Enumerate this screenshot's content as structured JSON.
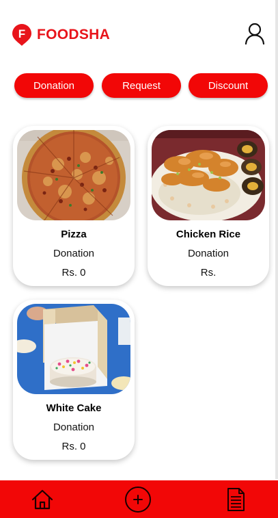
{
  "app": {
    "name": "FOODSHA",
    "logo_letter": "F",
    "accent": "#f20707"
  },
  "header": {
    "logo_icon": "foodsha-logo-icon",
    "profile_icon": "user-icon"
  },
  "tabs": [
    {
      "label": "Donation"
    },
    {
      "label": "Request"
    },
    {
      "label": "Discount"
    }
  ],
  "cards": [
    {
      "title": "Pizza",
      "type": "Donation",
      "price": "Rs. 0",
      "image": "pizza"
    },
    {
      "title": "Chicken Rice",
      "type": "Donation",
      "price": "Rs.",
      "image": "chicken-rice"
    },
    {
      "title": "White Cake",
      "type": "Donation",
      "price": "Rs. 0",
      "image": "white-cake"
    }
  ],
  "bottom_nav": [
    {
      "icon": "home-icon"
    },
    {
      "icon": "add-circle-icon"
    },
    {
      "icon": "document-icon"
    }
  ]
}
